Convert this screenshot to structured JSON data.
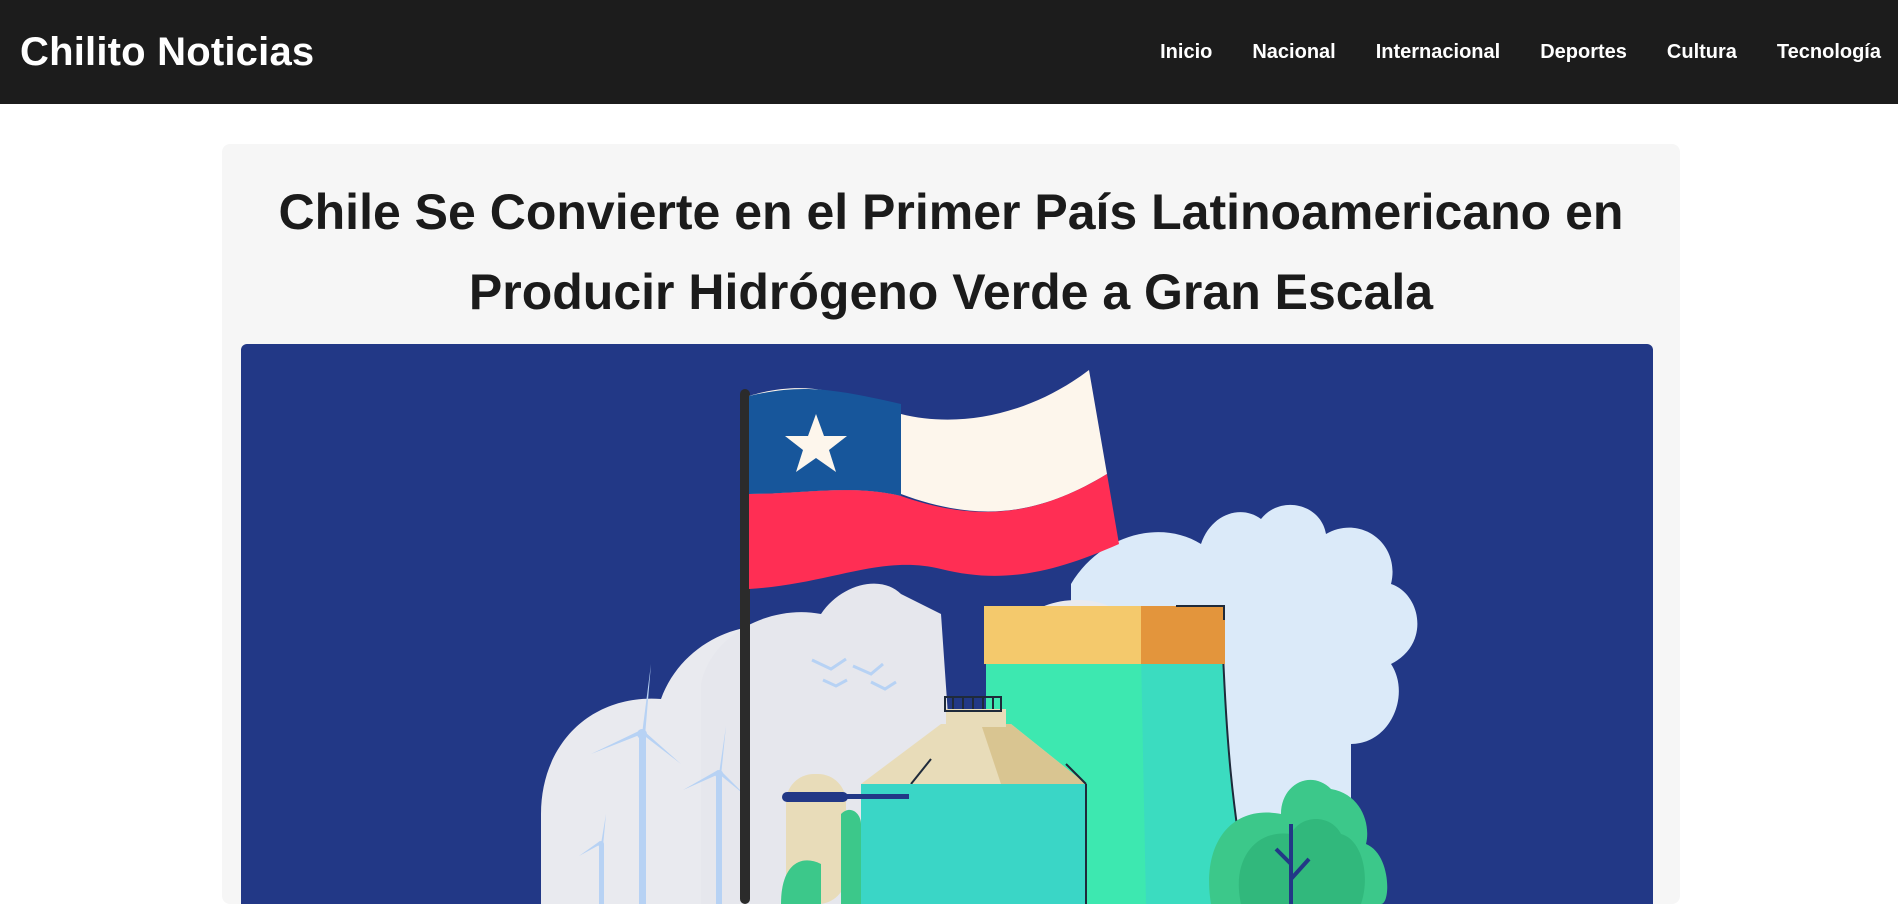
{
  "site": {
    "brand": "Chilito Noticias"
  },
  "nav": {
    "items": [
      {
        "label": "Inicio"
      },
      {
        "label": "Nacional"
      },
      {
        "label": "Internacional"
      },
      {
        "label": "Deportes"
      },
      {
        "label": "Cultura"
      },
      {
        "label": "Tecnología"
      }
    ]
  },
  "article": {
    "title": "Chile Se Convierte en el Primer País Latinoamericano en Producir Hidrógeno Verde a Gran Escala"
  },
  "colors": {
    "header_bg": "#1c1c1c",
    "hero_bg": "#223886",
    "flag_blue": "#17569b",
    "flag_white": "#fdf6ec",
    "flag_red": "#ff2e54",
    "tank_green": "#3de8b0"
  }
}
